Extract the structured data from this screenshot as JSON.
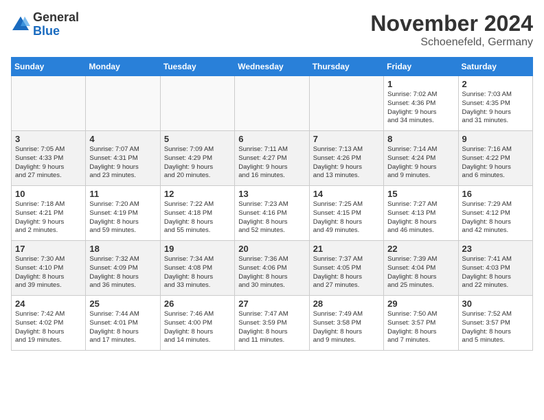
{
  "header": {
    "logo_general": "General",
    "logo_blue": "Blue",
    "title": "November 2024",
    "subtitle": "Schoenefeld, Germany"
  },
  "days_of_week": [
    "Sunday",
    "Monday",
    "Tuesday",
    "Wednesday",
    "Thursday",
    "Friday",
    "Saturday"
  ],
  "weeks": [
    {
      "days": [
        {
          "num": "",
          "info": "",
          "empty": true
        },
        {
          "num": "",
          "info": "",
          "empty": true
        },
        {
          "num": "",
          "info": "",
          "empty": true
        },
        {
          "num": "",
          "info": "",
          "empty": true
        },
        {
          "num": "",
          "info": "",
          "empty": true
        },
        {
          "num": "1",
          "info": "Sunrise: 7:02 AM\nSunset: 4:36 PM\nDaylight: 9 hours\nand 34 minutes.",
          "empty": false
        },
        {
          "num": "2",
          "info": "Sunrise: 7:03 AM\nSunset: 4:35 PM\nDaylight: 9 hours\nand 31 minutes.",
          "empty": false
        }
      ]
    },
    {
      "days": [
        {
          "num": "3",
          "info": "Sunrise: 7:05 AM\nSunset: 4:33 PM\nDaylight: 9 hours\nand 27 minutes.",
          "empty": false
        },
        {
          "num": "4",
          "info": "Sunrise: 7:07 AM\nSunset: 4:31 PM\nDaylight: 9 hours\nand 23 minutes.",
          "empty": false
        },
        {
          "num": "5",
          "info": "Sunrise: 7:09 AM\nSunset: 4:29 PM\nDaylight: 9 hours\nand 20 minutes.",
          "empty": false
        },
        {
          "num": "6",
          "info": "Sunrise: 7:11 AM\nSunset: 4:27 PM\nDaylight: 9 hours\nand 16 minutes.",
          "empty": false
        },
        {
          "num": "7",
          "info": "Sunrise: 7:13 AM\nSunset: 4:26 PM\nDaylight: 9 hours\nand 13 minutes.",
          "empty": false
        },
        {
          "num": "8",
          "info": "Sunrise: 7:14 AM\nSunset: 4:24 PM\nDaylight: 9 hours\nand 9 minutes.",
          "empty": false
        },
        {
          "num": "9",
          "info": "Sunrise: 7:16 AM\nSunset: 4:22 PM\nDaylight: 9 hours\nand 6 minutes.",
          "empty": false
        }
      ]
    },
    {
      "days": [
        {
          "num": "10",
          "info": "Sunrise: 7:18 AM\nSunset: 4:21 PM\nDaylight: 9 hours\nand 2 minutes.",
          "empty": false
        },
        {
          "num": "11",
          "info": "Sunrise: 7:20 AM\nSunset: 4:19 PM\nDaylight: 8 hours\nand 59 minutes.",
          "empty": false
        },
        {
          "num": "12",
          "info": "Sunrise: 7:22 AM\nSunset: 4:18 PM\nDaylight: 8 hours\nand 55 minutes.",
          "empty": false
        },
        {
          "num": "13",
          "info": "Sunrise: 7:23 AM\nSunset: 4:16 PM\nDaylight: 8 hours\nand 52 minutes.",
          "empty": false
        },
        {
          "num": "14",
          "info": "Sunrise: 7:25 AM\nSunset: 4:15 PM\nDaylight: 8 hours\nand 49 minutes.",
          "empty": false
        },
        {
          "num": "15",
          "info": "Sunrise: 7:27 AM\nSunset: 4:13 PM\nDaylight: 8 hours\nand 46 minutes.",
          "empty": false
        },
        {
          "num": "16",
          "info": "Sunrise: 7:29 AM\nSunset: 4:12 PM\nDaylight: 8 hours\nand 42 minutes.",
          "empty": false
        }
      ]
    },
    {
      "days": [
        {
          "num": "17",
          "info": "Sunrise: 7:30 AM\nSunset: 4:10 PM\nDaylight: 8 hours\nand 39 minutes.",
          "empty": false
        },
        {
          "num": "18",
          "info": "Sunrise: 7:32 AM\nSunset: 4:09 PM\nDaylight: 8 hours\nand 36 minutes.",
          "empty": false
        },
        {
          "num": "19",
          "info": "Sunrise: 7:34 AM\nSunset: 4:08 PM\nDaylight: 8 hours\nand 33 minutes.",
          "empty": false
        },
        {
          "num": "20",
          "info": "Sunrise: 7:36 AM\nSunset: 4:06 PM\nDaylight: 8 hours\nand 30 minutes.",
          "empty": false
        },
        {
          "num": "21",
          "info": "Sunrise: 7:37 AM\nSunset: 4:05 PM\nDaylight: 8 hours\nand 27 minutes.",
          "empty": false
        },
        {
          "num": "22",
          "info": "Sunrise: 7:39 AM\nSunset: 4:04 PM\nDaylight: 8 hours\nand 25 minutes.",
          "empty": false
        },
        {
          "num": "23",
          "info": "Sunrise: 7:41 AM\nSunset: 4:03 PM\nDaylight: 8 hours\nand 22 minutes.",
          "empty": false
        }
      ]
    },
    {
      "days": [
        {
          "num": "24",
          "info": "Sunrise: 7:42 AM\nSunset: 4:02 PM\nDaylight: 8 hours\nand 19 minutes.",
          "empty": false
        },
        {
          "num": "25",
          "info": "Sunrise: 7:44 AM\nSunset: 4:01 PM\nDaylight: 8 hours\nand 17 minutes.",
          "empty": false
        },
        {
          "num": "26",
          "info": "Sunrise: 7:46 AM\nSunset: 4:00 PM\nDaylight: 8 hours\nand 14 minutes.",
          "empty": false
        },
        {
          "num": "27",
          "info": "Sunrise: 7:47 AM\nSunset: 3:59 PM\nDaylight: 8 hours\nand 11 minutes.",
          "empty": false
        },
        {
          "num": "28",
          "info": "Sunrise: 7:49 AM\nSunset: 3:58 PM\nDaylight: 8 hours\nand 9 minutes.",
          "empty": false
        },
        {
          "num": "29",
          "info": "Sunrise: 7:50 AM\nSunset: 3:57 PM\nDaylight: 8 hours\nand 7 minutes.",
          "empty": false
        },
        {
          "num": "30",
          "info": "Sunrise: 7:52 AM\nSunset: 3:57 PM\nDaylight: 8 hours\nand 5 minutes.",
          "empty": false
        }
      ]
    }
  ]
}
